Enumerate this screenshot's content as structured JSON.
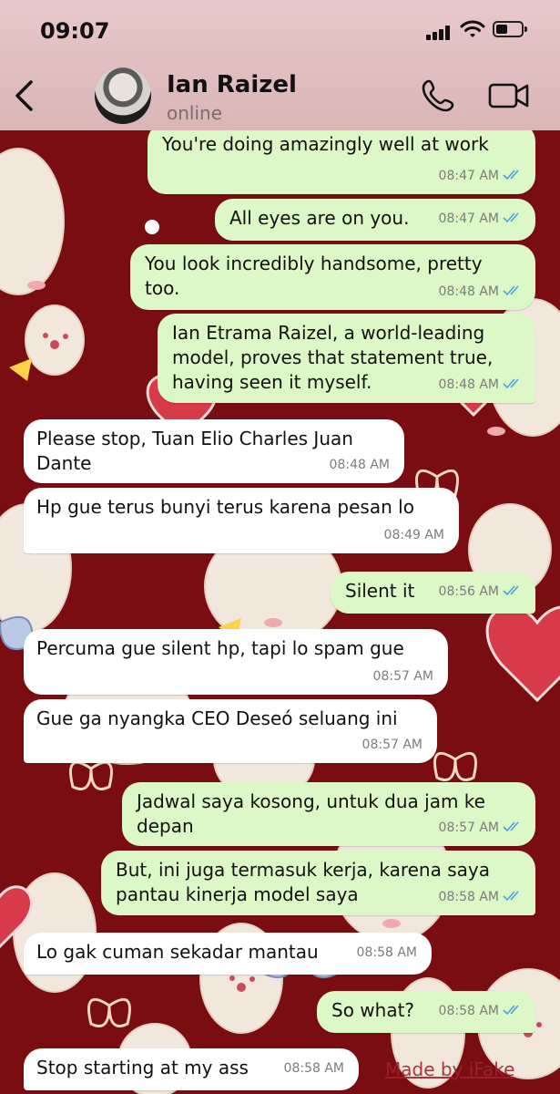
{
  "status_bar": {
    "time": "09:07"
  },
  "header": {
    "contact_name": "Ian Raizel",
    "contact_status": "online",
    "icons": {
      "back": "back-chevron-icon",
      "call": "phone-icon",
      "video": "video-camera-icon"
    }
  },
  "colors": {
    "wallpaper": "#7a0d12",
    "outgoing_bubble": "#dcf8c6",
    "incoming_bubble": "#ffffff",
    "read_ticks": "#4f9de8",
    "header": "#e7c8c9"
  },
  "messages": [
    {
      "direction": "out",
      "text": "You're doing amazingly well at work",
      "time": "08:47 AM",
      "read": true
    },
    {
      "direction": "out",
      "text": "All eyes are on you.",
      "time": "08:47 AM",
      "read": true
    },
    {
      "direction": "out",
      "text": "You look incredibly handsome, pretty\ntoo.",
      "time": "08:48 AM",
      "read": true
    },
    {
      "direction": "out",
      "text": "Ian Etrama Raizel, a world-leading\nmodel, proves that statement true,\nhaving seen it myself.",
      "time": "08:48 AM",
      "read": true
    },
    {
      "direction": "in",
      "text": "Please stop, Tuan Elio Charles Juan\nDante",
      "time": "08:48 AM"
    },
    {
      "direction": "in",
      "text": "Hp gue terus bunyi terus karena pesan lo",
      "time": "08:49 AM"
    },
    {
      "direction": "out",
      "text": "Silent it",
      "time": "08:56 AM",
      "read": true
    },
    {
      "direction": "in",
      "text": "Percuma gue silent hp, tapi lo spam gue",
      "time": "08:57 AM"
    },
    {
      "direction": "in",
      "text": "Gue ga nyangka CEO Deseó seluang ini",
      "time": "08:57 AM"
    },
    {
      "direction": "out",
      "text": "Jadwal saya kosong, untuk dua jam ke\ndepan",
      "time": "08:57 AM",
      "read": true
    },
    {
      "direction": "out",
      "text": "But, ini juga termasuk kerja, karena saya\npantau kinerja model saya",
      "time": "08:58 AM",
      "read": true
    },
    {
      "direction": "in",
      "text": "Lo gak cuman sekadar mantau",
      "time": "08:58 AM"
    },
    {
      "direction": "out",
      "text": "So what?",
      "time": "08:58 AM",
      "read": true
    },
    {
      "direction": "in",
      "text": "Stop starting at my ass",
      "time": "08:58 AM"
    }
  ],
  "watermark": "Made by iFake"
}
